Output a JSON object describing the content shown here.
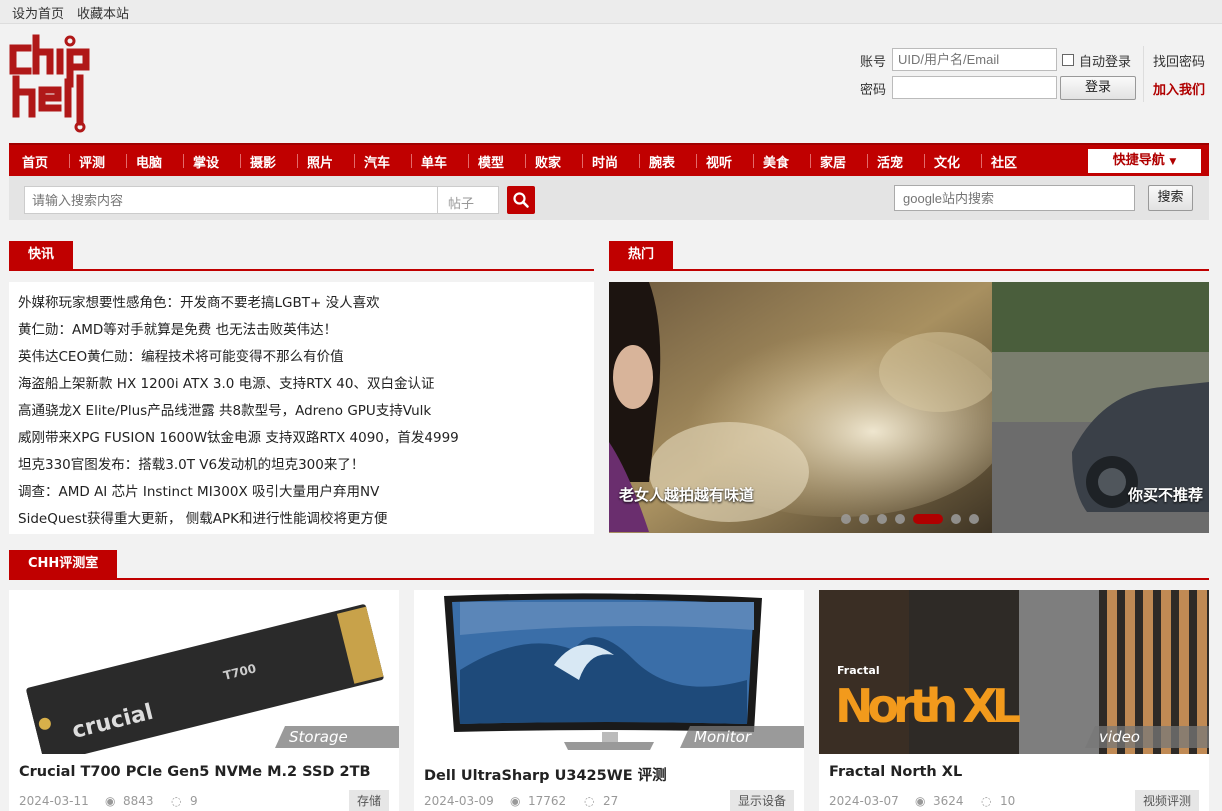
{
  "topbar": {
    "set_home": "设为首页",
    "bookmark": "收藏本站"
  },
  "login": {
    "account_label": "账号",
    "account_placeholder": "UID/用户名/Email",
    "auto_login": "自动登录",
    "forgot": "找回密码",
    "password_label": "密码",
    "login_button": "登录",
    "join": "加入我们"
  },
  "nav": {
    "items": [
      "首页",
      "评测",
      "电脑",
      "掌设",
      "摄影",
      "照片",
      "汽车",
      "单车",
      "模型",
      "败家",
      "时尚",
      "腕表",
      "视听",
      "美食",
      "家居",
      "活宠",
      "文化",
      "社区"
    ],
    "quick": "快捷导航"
  },
  "search": {
    "placeholder": "请输入搜索内容",
    "type": "帖子",
    "google_placeholder": "google站内搜索",
    "google_button": "搜索"
  },
  "news": {
    "title": "快讯",
    "items": [
      "外媒称玩家想要性感角色：开发商不要老搞LGBT+ 没人喜欢",
      "黄仁勋：AMD等对手就算是免费 也无法击败英伟达！",
      "英伟达CEO黄仁勋：编程技术将可能变得不那么有价值",
      "海盗船上架新款 HX 1200i ATX 3.0 电源、支持RTX 40、双白金认证",
      "高通骁龙X Elite/Plus产品线泄露 共8款型号，Adreno GPU支持Vulk",
      "威刚带来XPG FUSION 1600W钛金电源 支持双路RTX 4090，首发4999",
      "坦克330官图发布：搭载3.0T V6发动机的坦克300来了！",
      "调查：AMD AI 芯片 Instinct MI300X 吸引大量用户弃用NV",
      "SideQuest获得重大更新， 侧载APK和进行性能调校将更方便"
    ]
  },
  "hot": {
    "title": "热门",
    "slides": [
      {
        "caption": "老女人越拍越有味道"
      },
      {
        "caption": "你买不推荐"
      }
    ]
  },
  "lab": {
    "title": "CHH评测室",
    "cards": [
      {
        "title": "Crucial T700 PCIe Gen5 NVMe M.2 SSD 2TB",
        "tag": "Storage",
        "date": "2024-03-11",
        "views": "8843",
        "comments": "9",
        "category": "存储"
      },
      {
        "title": "Dell UltraSharp U3425WE 评测",
        "tag": "Monitor",
        "date": "2024-03-09",
        "views": "17762",
        "comments": "27",
        "category": "显示设备"
      },
      {
        "title": "Fractal North XL",
        "tag": "video",
        "date": "2024-03-07",
        "views": "3624",
        "comments": "10",
        "category": "视频评测"
      }
    ]
  }
}
